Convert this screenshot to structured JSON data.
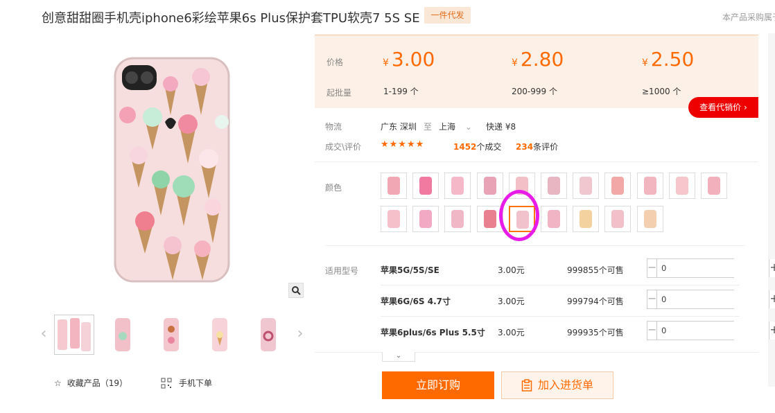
{
  "product": {
    "title": "创意甜甜圈手机壳iphone6彩绘苹果6s Plus保护套TPU软壳7 5S SE",
    "badge": "一件代发",
    "top_right_text": "本产品采购属于"
  },
  "price_block": {
    "price_label": "价格",
    "batch_label": "起批量",
    "currency": "¥",
    "tiers": [
      {
        "price": "3.00",
        "qty": "1-199 个"
      },
      {
        "price": "2.80",
        "qty": "200-999 个"
      },
      {
        "price": "2.50",
        "qty": "≥1000 个"
      }
    ],
    "agent_button": "查看代销价"
  },
  "logistics": {
    "label": "物流",
    "from": "广东 深圳",
    "to_word": "至",
    "to": "上海",
    "express": "快递 ¥8"
  },
  "deal": {
    "label": "成交\\评价",
    "stars": "★★★★★",
    "deals_count": "1452",
    "deals_suffix": "个成交",
    "reviews_count": "234",
    "reviews_suffix": "条评价"
  },
  "color": {
    "label": "颜色",
    "swatch_colors": [
      "#f2a7b5",
      "#f07aa0",
      "#f5b8c8",
      "#e9a3b6",
      "#f3c0c8",
      "#e7b6c2",
      "#f0c6cf",
      "#f3a8a8",
      "#f2b6c0",
      "#f6c6cc",
      "#f2b0bc",
      "#f5c0ca",
      "#f2a9c4",
      "#f0b8c6",
      "#e88090",
      "#f1c2cc",
      "#f0b4c4",
      "#f4d2a0",
      "#f1c0c8",
      "#f3cfb0"
    ],
    "selected_index": 15
  },
  "models": {
    "label": "适用型号",
    "rows": [
      {
        "name": "苹果5G/5S/SE",
        "price": "3.00元",
        "stock": "999855个可售",
        "qty": "0"
      },
      {
        "name": "苹果6G/6S 4.7寸",
        "price": "3.00元",
        "stock": "999794个可售",
        "qty": "0"
      },
      {
        "name": "苹果6plus/6s Plus 5.5寸",
        "price": "3.00元",
        "stock": "999935个可售",
        "qty": "0"
      }
    ]
  },
  "actions": {
    "buy_now": "立即订购",
    "add_to_cart": "加入进货单",
    "favorite": "收藏产品（19）",
    "mobile_order": "手机下单"
  }
}
